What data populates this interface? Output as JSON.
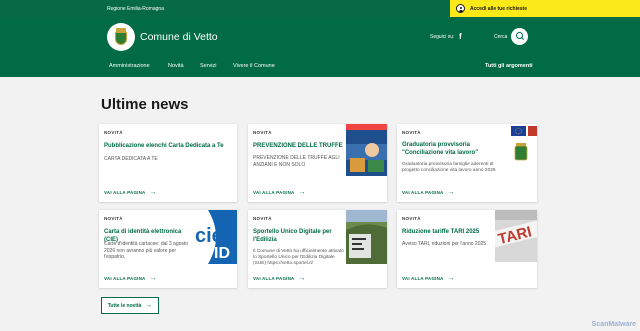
{
  "topbar": {
    "region": "Regione Emilia-Romagna",
    "login": "Accedi alle tue richieste"
  },
  "header": {
    "site_name": "Comune di Vetto",
    "social_label": "Seguici su:",
    "search_label": "Cerca"
  },
  "nav": {
    "items": [
      "Amministrazione",
      "Novità",
      "Servizi",
      "Vivere il Comune"
    ],
    "all_topics": "Tutti gli argomenti"
  },
  "news": {
    "title": "Ultime news",
    "read_more": "VAI ALLA PAGINA",
    "all_news": "Tutte le novità",
    "cards": [
      {
        "category": "NOVITÀ",
        "title": "Pubblicazione elenchi Carta Dedicata a Te",
        "desc": "CARTA DEDICATA A TE"
      },
      {
        "category": "NOVITÀ",
        "title": "PREVENZIONE DELLE TRUFFE",
        "desc": "PREVENZIONE DELLE TRUFFE AGLI ANZIANI E NON SOLO"
      },
      {
        "category": "NOVITÀ",
        "title": "Graduatoria provvisoria \"Conciliazione vita lavoro\"",
        "desc": "Graduatoria provvisoria famiglie aderenti al progetto conciliazione vita lavoro anno 2025"
      },
      {
        "category": "NOVITÀ",
        "title": "Carta di identità elettronica (CIE)",
        "desc": "Carte d'identità cartacee: dal 3 agosto 2026 non avranno più valore per l'espatrio."
      },
      {
        "category": "NOVITÀ",
        "title": "Sportello Unico Digitale per l'Edilizia",
        "desc": "Il Comune di Vetto ha ufficialmente attivato lo Sportello Unico per l'Edilizia Digitale (SUE) https://vetto.sportel.it/"
      },
      {
        "category": "NOVITÀ",
        "title": "Riduzione tariffe TARI 2025",
        "desc": "Avviso TARI, riduzioni per l'anno 2025"
      }
    ]
  },
  "colors": {
    "primary": "#006b44",
    "accent": "#fce91a",
    "background": "#f2f2f2"
  },
  "icons": {
    "login": "user-icon",
    "social": "facebook-icon",
    "search": "search-icon",
    "arrow": "arrow-right-icon"
  },
  "watermark": "ScanMalware"
}
